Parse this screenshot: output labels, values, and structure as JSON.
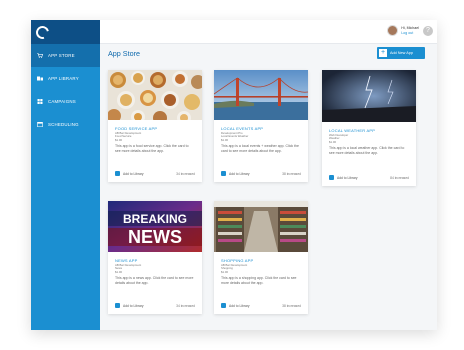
{
  "sidebar": {
    "items": [
      {
        "label": "APP STORE",
        "icon": "cart-icon",
        "active": true
      },
      {
        "label": "APP LIBRARY",
        "icon": "library-icon",
        "active": false
      },
      {
        "label": "CAMPAIGNS",
        "icon": "grid-icon",
        "active": false
      },
      {
        "label": "SCHEDULING",
        "icon": "calendar-icon",
        "active": false
      }
    ]
  },
  "header": {
    "user_name": "Hi, Michael",
    "logout_label": "Log out",
    "help_label": "?"
  },
  "main": {
    "title": "App Store",
    "add_button_label": "Add New App"
  },
  "cards": [
    {
      "title": "FOOD SERVICE APP",
      "meta": [
        "AB Bar Development",
        "Food Service",
        "$1.00"
      ],
      "description": "This app is a food service app. Click the card to see more details about the app.",
      "add_label": "Add to Library",
      "included": "34 increased"
    },
    {
      "title": "LOCAL EVENTS APP",
      "meta": [
        "Development Pro",
        "Local Events Weather",
        "$1.00"
      ],
      "description": "This app is a local events + weather app. Click the card to see more details about the app.",
      "add_label": "Add to Library",
      "included": "38 increased"
    },
    {
      "title": "LOCAL WEATHER APP",
      "meta": [
        "Web Developer",
        "Weather",
        "$1.00"
      ],
      "description": "This app is a local weather app. Click the card to see more details about the app.",
      "add_label": "Add to Library",
      "included": "84 increased"
    },
    {
      "title": "NEWS APP",
      "meta": [
        "AB Bar Development",
        "News",
        "$1.00"
      ],
      "description": "This app is a news app. Click the card to see more details about the app.",
      "add_label": "Add to Library",
      "included": "34 increased",
      "image_text": [
        "BREAKING",
        "NEWS"
      ]
    },
    {
      "title": "SHOPPING APP",
      "meta": [
        "AB Bar Development",
        "Shopping",
        "$1.00"
      ],
      "description": "This app is a shopping app. Click the card to see more details about the app.",
      "add_label": "Add to Library",
      "included": "38 increased"
    }
  ],
  "colors": {
    "accent": "#1b8fd1",
    "sidebar_dark": "#0d4f86",
    "title": "#0f6aad"
  }
}
